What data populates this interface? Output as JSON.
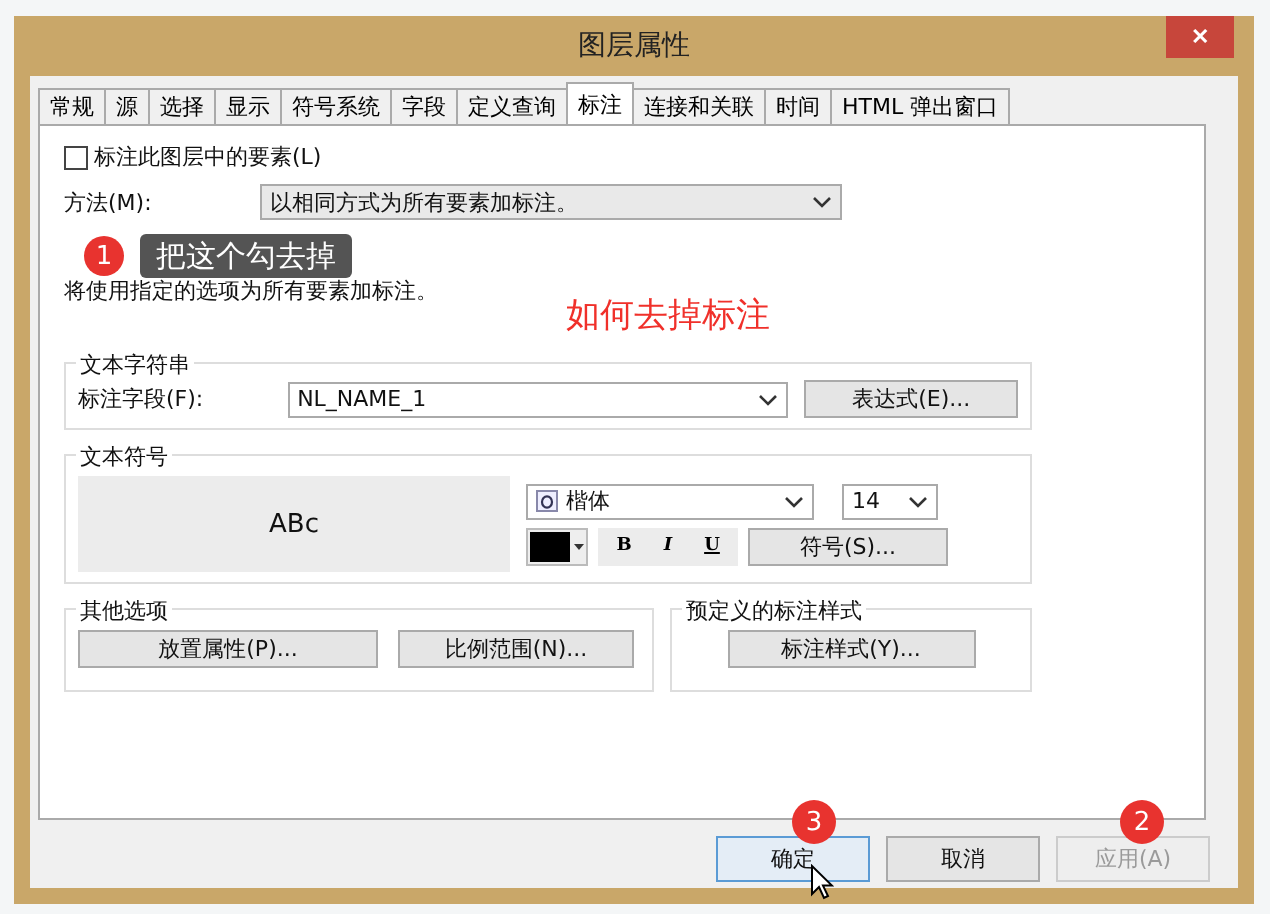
{
  "window": {
    "title": "图层属性",
    "close": "✕"
  },
  "tabs": [
    {
      "label": "常规",
      "selected": false
    },
    {
      "label": "源",
      "selected": false
    },
    {
      "label": "选择",
      "selected": false
    },
    {
      "label": "显示",
      "selected": false
    },
    {
      "label": "符号系统",
      "selected": false
    },
    {
      "label": "字段",
      "selected": false
    },
    {
      "label": "定义查询",
      "selected": false
    },
    {
      "label": "标注",
      "selected": true
    },
    {
      "label": "连接和关联",
      "selected": false
    },
    {
      "label": "时间",
      "selected": false
    },
    {
      "label": "HTML 弹出窗口",
      "selected": false
    }
  ],
  "label_checkbox": {
    "label": "标注此图层中的要素(L)",
    "checked": false
  },
  "method": {
    "label": "方法(M):",
    "value": "以相同方式为所有要素加标注。"
  },
  "description": "将使用指定的选项为所有要素加标注。",
  "text_string": {
    "title": "文本字符串",
    "field_label": "标注字段(F):",
    "field_value": "NL_NAME_1",
    "expression_button": "表达式(E)..."
  },
  "text_symbol": {
    "title": "文本符号",
    "preview": "ABc",
    "font": "楷体",
    "size": "14",
    "color": "#000000",
    "bold": "B",
    "italic": "I",
    "underline": "U",
    "symbol_button": "符号(S)..."
  },
  "other_options": {
    "title": "其他选项",
    "buttons": [
      "放置属性(P)...",
      "比例范围(N)..."
    ]
  },
  "predefined": {
    "title": "预定义的标注样式",
    "button": "标注样式(Y)..."
  },
  "buttons": [
    {
      "label": "确定",
      "disabled": false,
      "focused": true
    },
    {
      "label": "取消",
      "disabled": false,
      "focused": false
    },
    {
      "label": "应用(A)",
      "disabled": true,
      "focused": false
    }
  ],
  "annotations": {
    "tooltip_badge": "1",
    "tooltip": "把这个勾去掉",
    "heading": "如何去掉标注",
    "ok_badge": "3",
    "apply_badge": "2"
  }
}
